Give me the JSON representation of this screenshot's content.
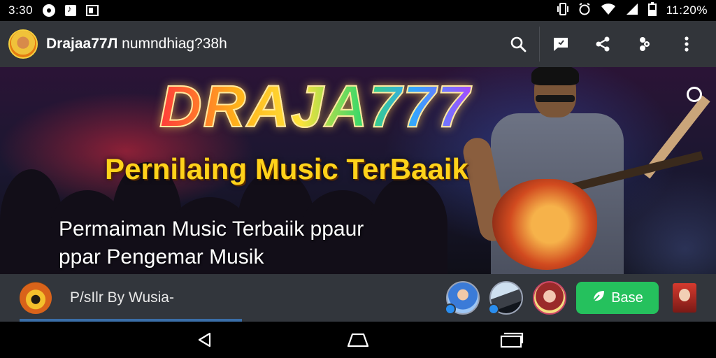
{
  "status_bar": {
    "time": "3:30",
    "right_text": "11:20%",
    "icons": [
      "circle-icon",
      "music-icon",
      "image-icon",
      "vibrate-icon",
      "alarm-icon",
      "wifi-icon",
      "signal-icon",
      "battery-icon"
    ]
  },
  "app_bar": {
    "title_bold": "Drajaa77Л",
    "title_rest": " numndhiag?38h",
    "actions": [
      "search-icon",
      "message-icon",
      "share-icon",
      "shuffle-icon",
      "more-vertical-icon"
    ]
  },
  "banner": {
    "brand": "DRAJA777",
    "subtitle": "Pernilaing Music TerBaaik",
    "description": "Permaiman Music Terbaiik ppaur ppar Pengemar Musik"
  },
  "info_bar": {
    "text": "Р/ѕIlr By Wusia-",
    "save_label": "Base"
  },
  "colors": {
    "app_bar_bg": "#32353a",
    "save_button": "#25c15d",
    "subtitle_yellow": "#ffd21a"
  }
}
